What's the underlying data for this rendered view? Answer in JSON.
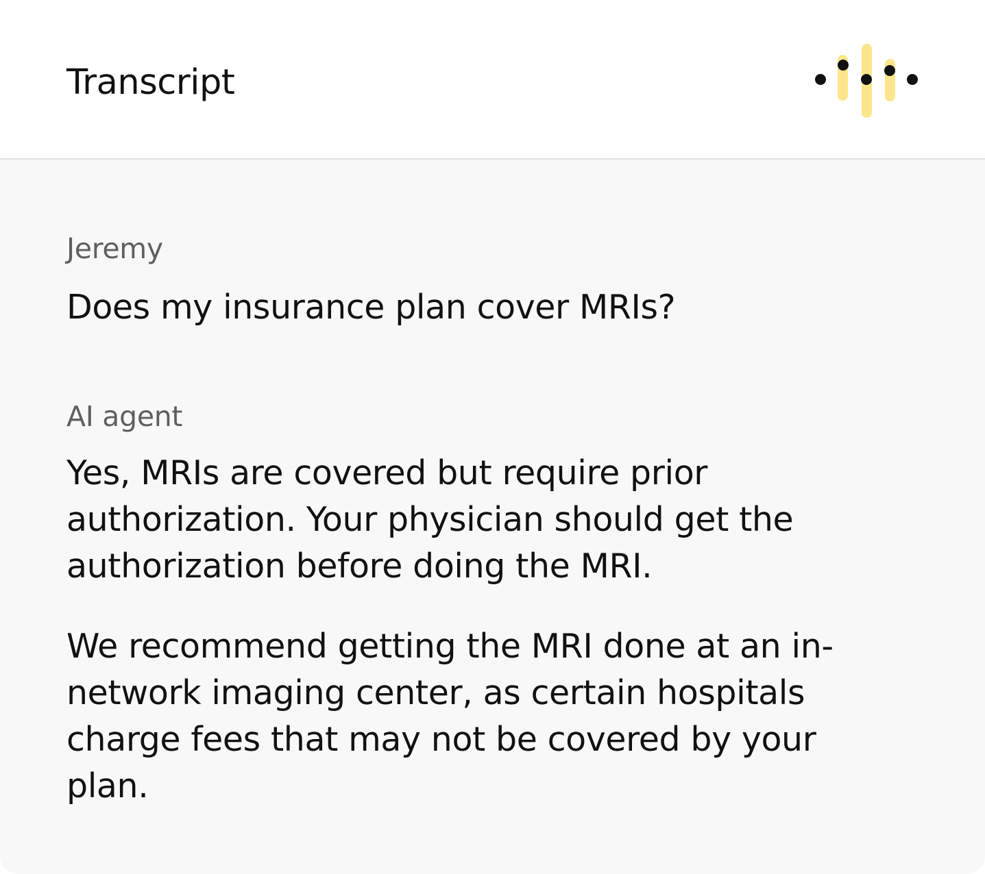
{
  "header": {
    "title": "Transcript",
    "icon": "voice-waveform-icon",
    "accent_color": "#fbe68c"
  },
  "transcript": [
    {
      "speaker": "Jeremy",
      "paragraphs": [
        "Does my insurance plan cover MRIs?"
      ]
    },
    {
      "speaker": "AI agent",
      "paragraphs": [
        "Yes, MRIs are covered but require prior authorization. Your physician should get the authorization before doing the MRI.",
        "We recommend getting the MRI done at an in-network imaging center, as certain hospitals charge fees that may not be covered by your plan."
      ]
    }
  ]
}
